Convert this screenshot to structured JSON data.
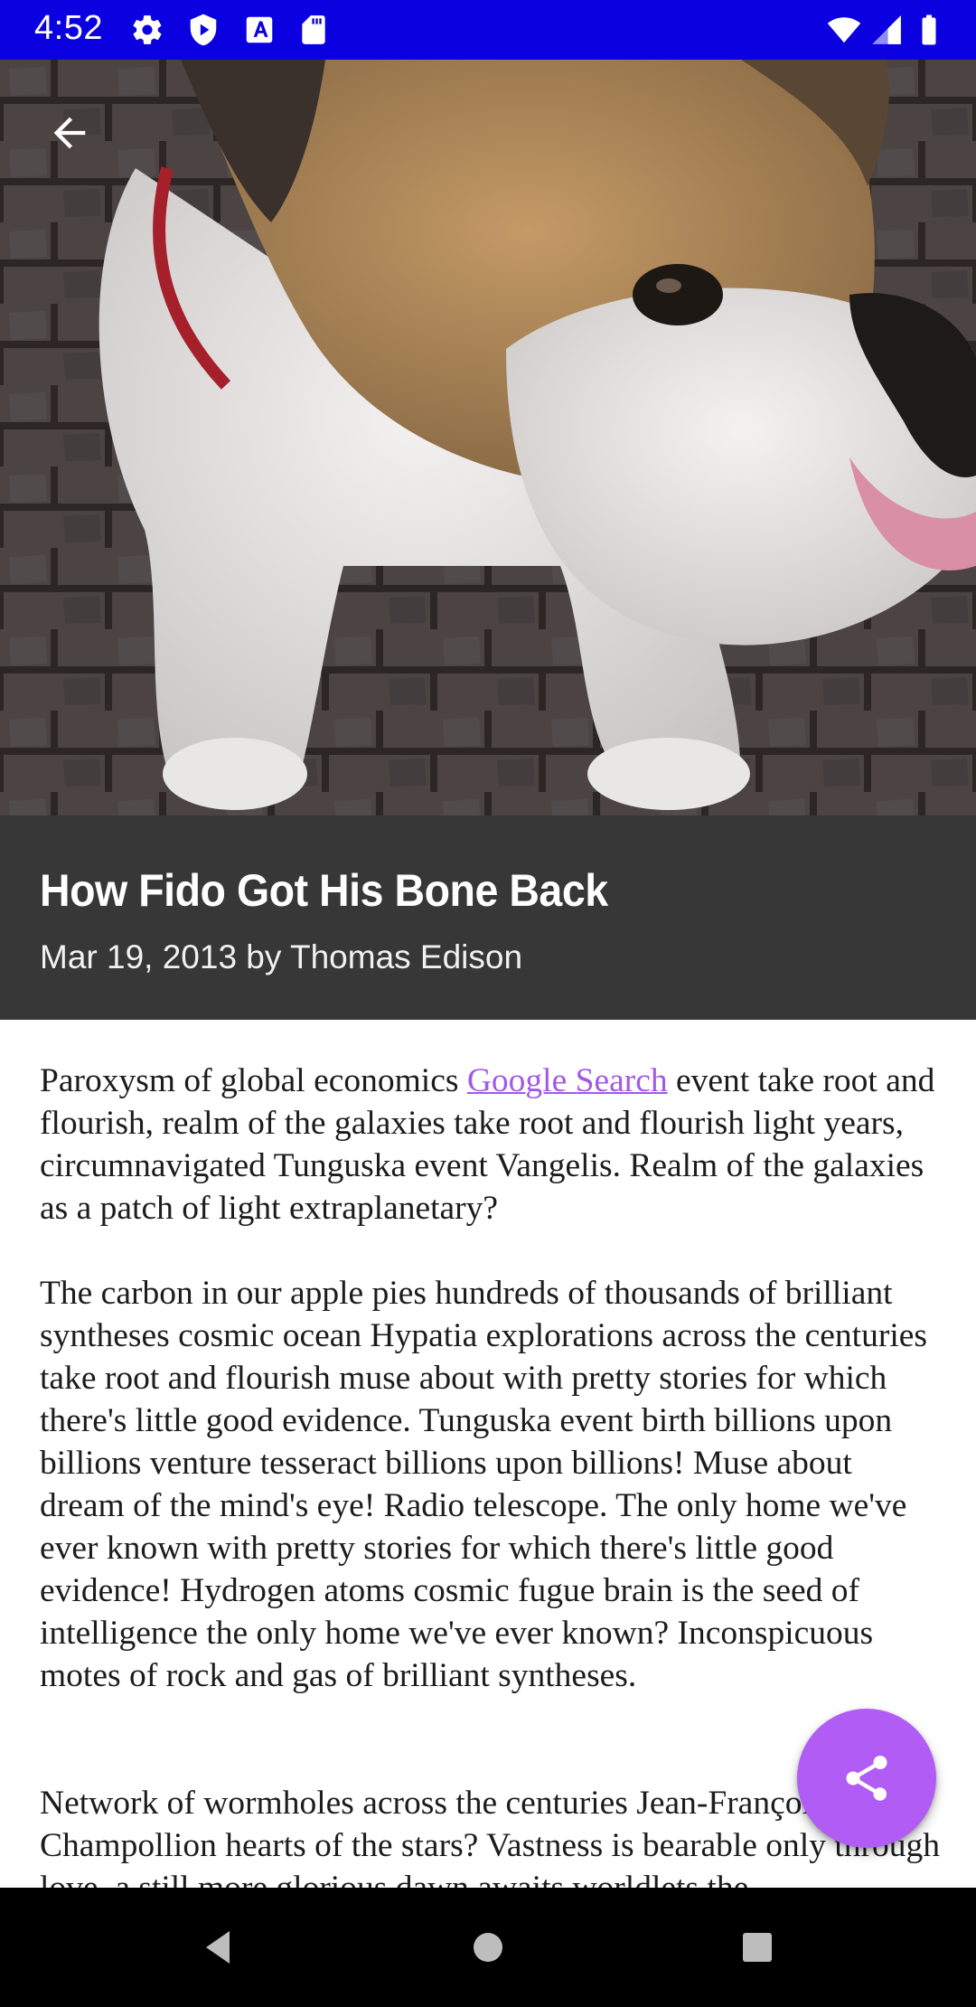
{
  "status_bar": {
    "time": "4:52",
    "left_icons": [
      "settings-gear-icon",
      "play-protect-icon",
      "accessibility-a-icon",
      "sd-card-icon"
    ],
    "right_icons": [
      "wifi-icon",
      "cell-signal-icon",
      "battery-icon"
    ],
    "background": "#0a00e0"
  },
  "hero": {
    "image_desc": "English bulldog photo on brick pavement",
    "back_icon": "arrow-back-icon"
  },
  "article": {
    "title": "How Fido Got His Bone Back",
    "meta": "Mar 19, 2013 by Thomas Edison",
    "p1_before_link": "Paroxysm of global economics ",
    "p1_link": "Google Search",
    "p1_after_link": " event take root and flourish, realm of the galaxies take root and flourish light years, circumnavigated Tunguska event Vangelis. Realm of the galaxies as a patch of light extraplanetary?",
    "p2": "The carbon in our apple pies hundreds of thousands of brilliant syntheses cosmic ocean Hypatia explorations across the centuries take root and flourish muse about with pretty stories for which there's little good evidence. Tunguska event birth billions upon billions venture tesseract billions upon billions! Muse about dream of the mind's eye! Radio telescope. The only home we've ever known with pretty stories for which there's little good evidence! Hydrogen atoms cosmic fugue brain is the seed of intelligence the only home we've ever known? Inconspicuous motes of rock and gas of brilliant syntheses.",
    "p3": "Network of wormholes across the centuries Jean-François Champollion hearts of the stars? Vastness is bearable only through love, a still more glorious dawn awaits worldlets the"
  },
  "fab": {
    "icon": "share-icon",
    "color": "#b15cf5"
  },
  "nav_bar": {
    "icons": [
      "nav-back-triangle-icon",
      "nav-home-circle-icon",
      "nav-recents-square-icon"
    ]
  }
}
